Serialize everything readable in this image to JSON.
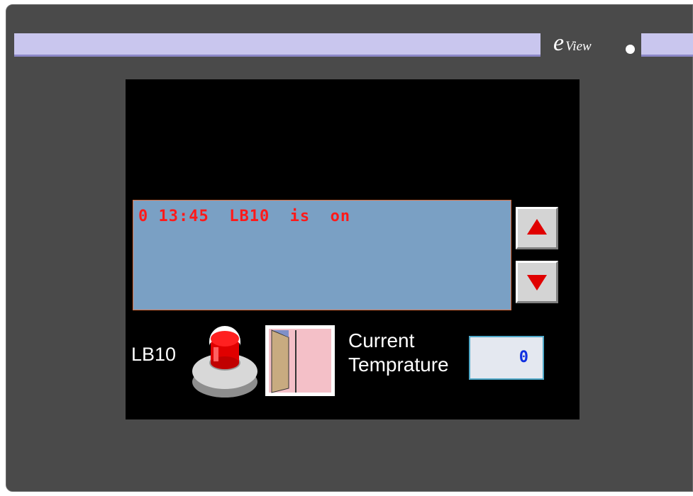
{
  "brand": {
    "logo_e": "e",
    "logo_view": "View"
  },
  "alarm": {
    "message": "0 13:45  LB10  is  on"
  },
  "controls": {
    "lb10_label": "LB10",
    "temperature_label_line1": "Current",
    "temperature_label_line2": "Temprature",
    "temperature_value": "0"
  },
  "icons": {
    "scroll_up": "triangle-up-icon",
    "scroll_down": "triangle-down-icon",
    "lamp": "red-lamp-button-icon",
    "door": "door-icon"
  },
  "colors": {
    "bezel": "#4a4a4a",
    "brand_strip": "#c9c6ee",
    "screen": "#000000",
    "alarm_bg": "#7aa0c4",
    "alarm_text": "#ff1a1a",
    "arrow": "#e00000",
    "temp_value": "#1030e0"
  }
}
